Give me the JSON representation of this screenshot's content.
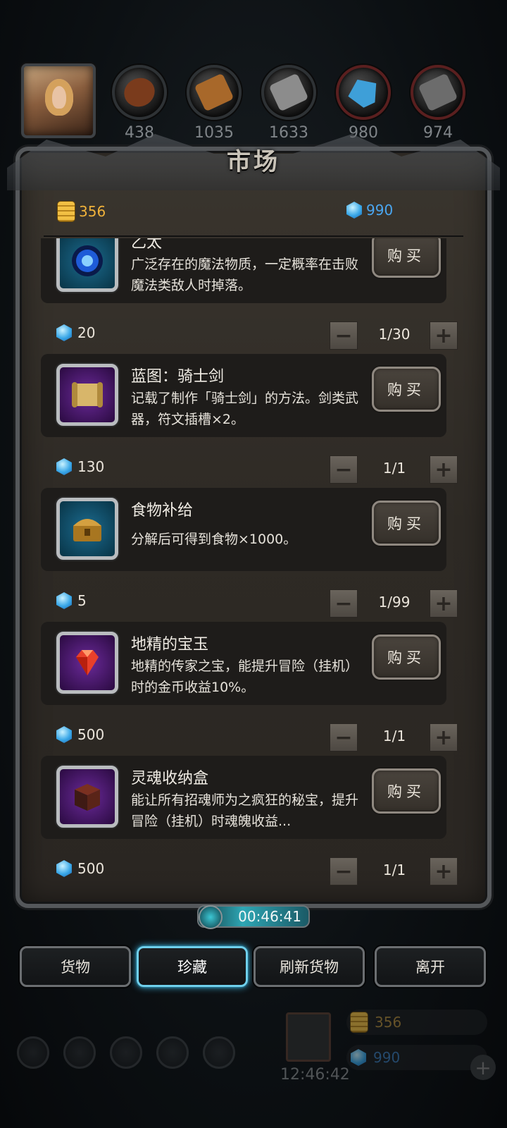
{
  "resources": [
    {
      "name": "meat-icon",
      "value": "438",
      "color": "#7a3b1c"
    },
    {
      "name": "wood-icon",
      "value": "1035",
      "color": "#a8682a"
    },
    {
      "name": "iron-icon",
      "value": "1633",
      "color": "#8c8c8c"
    },
    {
      "name": "crystal-icon",
      "value": "980",
      "color": "#3e9fd8"
    },
    {
      "name": "stone-icon",
      "value": "974",
      "color": "#6c6c6c"
    }
  ],
  "panel": {
    "title": "市场"
  },
  "currency": {
    "gold": "356",
    "gems": "990"
  },
  "items": [
    {
      "name": "乙太",
      "desc": "广泛存在的魔法物质，一定概率在击败魔法类敌人时掉落。",
      "price": "20",
      "qty": "1/30",
      "buy": "购买",
      "frame": "blue",
      "icon": "ether-orb-icon"
    },
    {
      "name": "蓝图：骑士剑",
      "desc": "记载了制作「骑士剑」的方法。剑类武器，符文插槽×2。",
      "price": "130",
      "qty": "1/1",
      "buy": "购买",
      "frame": "purple",
      "icon": "scroll-icon"
    },
    {
      "name": "食物补给",
      "desc": "分解后可得到食物×1000。",
      "price": "5",
      "qty": "1/99",
      "buy": "购买",
      "frame": "blue",
      "icon": "chest-icon"
    },
    {
      "name": "地精的宝玉",
      "desc": "地精的传家之宝，能提升冒险（挂机）时的金币收益10%。",
      "price": "500",
      "qty": "1/1",
      "buy": "购买",
      "frame": "purple",
      "icon": "ruby-icon"
    },
    {
      "name": "灵魂收纳盒",
      "desc": "能让所有招魂师为之疯狂的秘宝，提升冒险（挂机）时魂魄收益...",
      "price": "500",
      "qty": "1/1",
      "buy": "购买",
      "frame": "purple",
      "icon": "soul-box-icon"
    }
  ],
  "timer": "00:46:41",
  "tabs": [
    {
      "label": "货物",
      "active": false
    },
    {
      "label": "珍藏",
      "active": true
    },
    {
      "label": "刷新货物",
      "active": false
    },
    {
      "label": "离开",
      "active": false
    }
  ],
  "hud": {
    "clock": "12:46:42",
    "gold": "356",
    "gems": "990"
  }
}
